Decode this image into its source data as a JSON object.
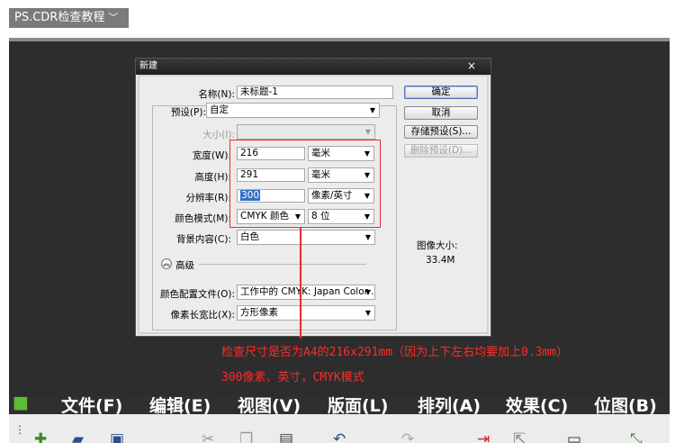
{
  "tag": {
    "label": "PS.CDR检查教程",
    "chevron": "﹀"
  },
  "dialog": {
    "title": "新建",
    "close": "×",
    "name_label": "名称(N):",
    "name_value": "未标题-1",
    "preset_label": "预设(P):",
    "preset_value": "自定",
    "size_label": "大小(I):",
    "width_label": "宽度(W):",
    "width_value": "216",
    "width_unit": "毫米",
    "height_label": "高度(H):",
    "height_value": "291",
    "height_unit": "毫米",
    "resolution_label": "分辨率(R):",
    "resolution_value": "300",
    "resolution_unit": "像素/英寸",
    "color_mode_label": "颜色模式(M):",
    "color_mode_value": "CMYK 颜色",
    "bit_depth_value": "8 位",
    "background_label": "背景内容(C):",
    "background_value": "白色",
    "advanced_label": "高级",
    "profile_label": "颜色配置文件(O):",
    "profile_value": "工作中的 CMYK: Japan Color ...",
    "pixel_aspect_label": "像素长宽比(X):",
    "pixel_aspect_value": "方形像素",
    "ok_button": "确定",
    "cancel_button": "取消",
    "save_preset_button": "存储预设(S)...",
    "delete_preset_button": "删除预设(D)...",
    "image_size_label": "图像大小:",
    "image_size_value": "33.4M"
  },
  "annotation": {
    "line1": "检查尺寸是否为A4的216x291mm（因为上下左右均要加上0.3mm）",
    "line2": "300像素、英寸，CMYK模式",
    "color": "#ff2a2a"
  },
  "menubar": {
    "items": [
      "文件(F)",
      "编辑(E)",
      "视图(V)",
      "版面(L)",
      "排列(A)",
      "效果(C)",
      "位图(B)"
    ]
  },
  "toolbar": {
    "icons": [
      "new-icon",
      "open-icon",
      "save-icon",
      "cut-icon",
      "copy-icon",
      "paste-icon",
      "undo-icon",
      "redo-icon",
      "import-icon",
      "export-icon",
      "application-icon",
      "zoom-icon"
    ]
  }
}
